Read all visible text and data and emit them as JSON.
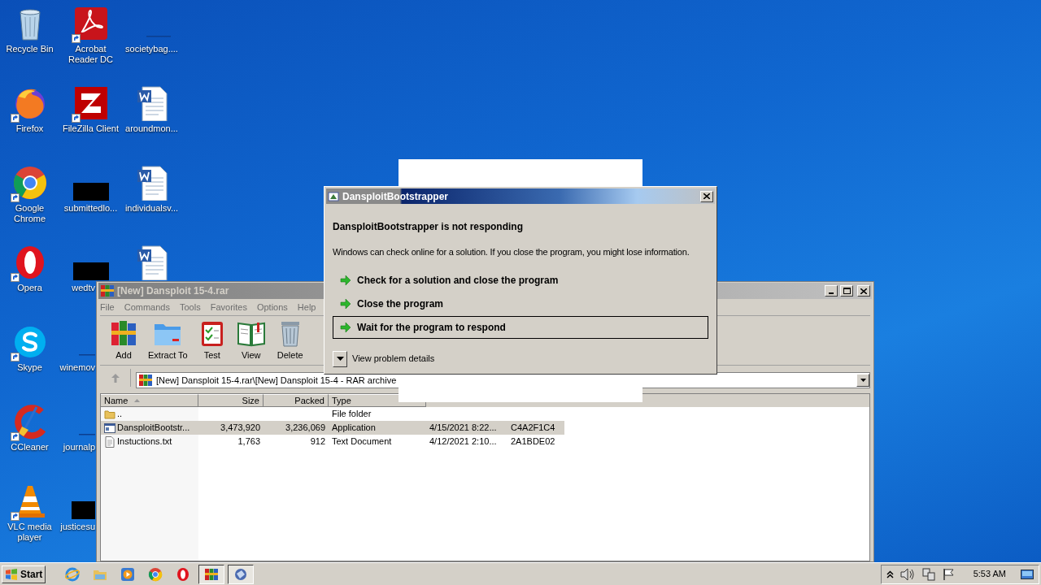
{
  "desktop_icons": {
    "columns": [
      [
        {
          "label": "Recycle Bin",
          "kind": "recycle",
          "shortcut": false
        },
        {
          "label": "Firefox",
          "kind": "firefox",
          "shortcut": true
        },
        {
          "label": "Google Chrome",
          "kind": "chrome",
          "shortcut": true
        },
        {
          "label": "Opera",
          "kind": "opera",
          "shortcut": true
        },
        {
          "label": "Skype",
          "kind": "skype",
          "shortcut": true
        },
        {
          "label": "CCleaner",
          "kind": "ccleaner",
          "shortcut": true
        },
        {
          "label": "VLC media player",
          "kind": "vlc",
          "shortcut": true
        }
      ],
      [
        {
          "label": "Acrobat Reader DC",
          "kind": "acrobat",
          "shortcut": true
        },
        {
          "label": "FileZilla Client",
          "kind": "filezilla",
          "shortcut": true
        },
        {
          "label": "submittedlo...",
          "kind": "black",
          "shortcut": false
        },
        {
          "label": "wedtv",
          "kind": "black",
          "shortcut": false
        },
        {
          "label": "winemov",
          "kind": "blank",
          "shortcut": false
        },
        {
          "label": "journalp",
          "kind": "blank",
          "shortcut": false
        },
        {
          "label": "justicesu",
          "kind": "black",
          "shortcut": false
        }
      ],
      [
        {
          "label": "societybag....",
          "kind": "blank",
          "shortcut": false
        },
        {
          "label": "aroundmon...",
          "kind": "word",
          "shortcut": false
        },
        {
          "label": "individualsv...",
          "kind": "word",
          "shortcut": false
        },
        {
          "kind": "word",
          "shortcut": false
        }
      ]
    ]
  },
  "archive_window": {
    "title": "[New] Dansploit 15-4.rar",
    "menu": [
      "File",
      "Commands",
      "Tools",
      "Favorites",
      "Options",
      "Help"
    ],
    "toolbar": [
      {
        "label": "Add",
        "kind": "add"
      },
      {
        "label": "Extract To",
        "kind": "extract"
      },
      {
        "label": "Test",
        "kind": "test"
      },
      {
        "label": "View",
        "kind": "view"
      },
      {
        "label": "Delete",
        "kind": "delete"
      }
    ],
    "address": "[New] Dansploit 15-4.rar\\[New] Dansploit 15-4 - RAR archive",
    "columns": [
      "Name",
      "Size",
      "Packed",
      "Type"
    ],
    "rows": [
      {
        "kind": "folder",
        "selected": false,
        "cells": [
          "..",
          "",
          "",
          "File folder",
          "",
          ""
        ]
      },
      {
        "kind": "app",
        "selected": true,
        "cells": [
          "DansploitBootstr...",
          "3,473,920",
          "3,236,069",
          "Application",
          "4/15/2021 8:22...",
          "C4A2F1C4"
        ]
      },
      {
        "kind": "text",
        "selected": false,
        "cells": [
          "Instuctions.txt",
          "1,763",
          "912",
          "Text Document",
          "4/12/2021 2:10...",
          "2A1BDE02"
        ]
      }
    ]
  },
  "dialog": {
    "title": "DansploitBootstrapper",
    "heading": "DansploitBootstrapper is not responding",
    "message": "Windows can check online for a solution. If you close the program, you might lose information.",
    "options": [
      {
        "label": "Check for a solution and close the program",
        "selected": false
      },
      {
        "label": "Close the program",
        "selected": false
      },
      {
        "label": "Wait for the program to respond",
        "selected": true
      }
    ],
    "details": {
      "label": "View problem details",
      "expanded": false
    }
  },
  "taskbar": {
    "start": "Start",
    "items": [
      {
        "kind": "ie",
        "active": false
      },
      {
        "kind": "folder",
        "active": false
      },
      {
        "kind": "media",
        "active": false
      },
      {
        "kind": "chrome",
        "active": false
      },
      {
        "kind": "opera",
        "active": false
      },
      {
        "kind": "winrar",
        "active": true
      },
      {
        "kind": "app",
        "active": true
      }
    ],
    "clock": "5:53 AM"
  }
}
